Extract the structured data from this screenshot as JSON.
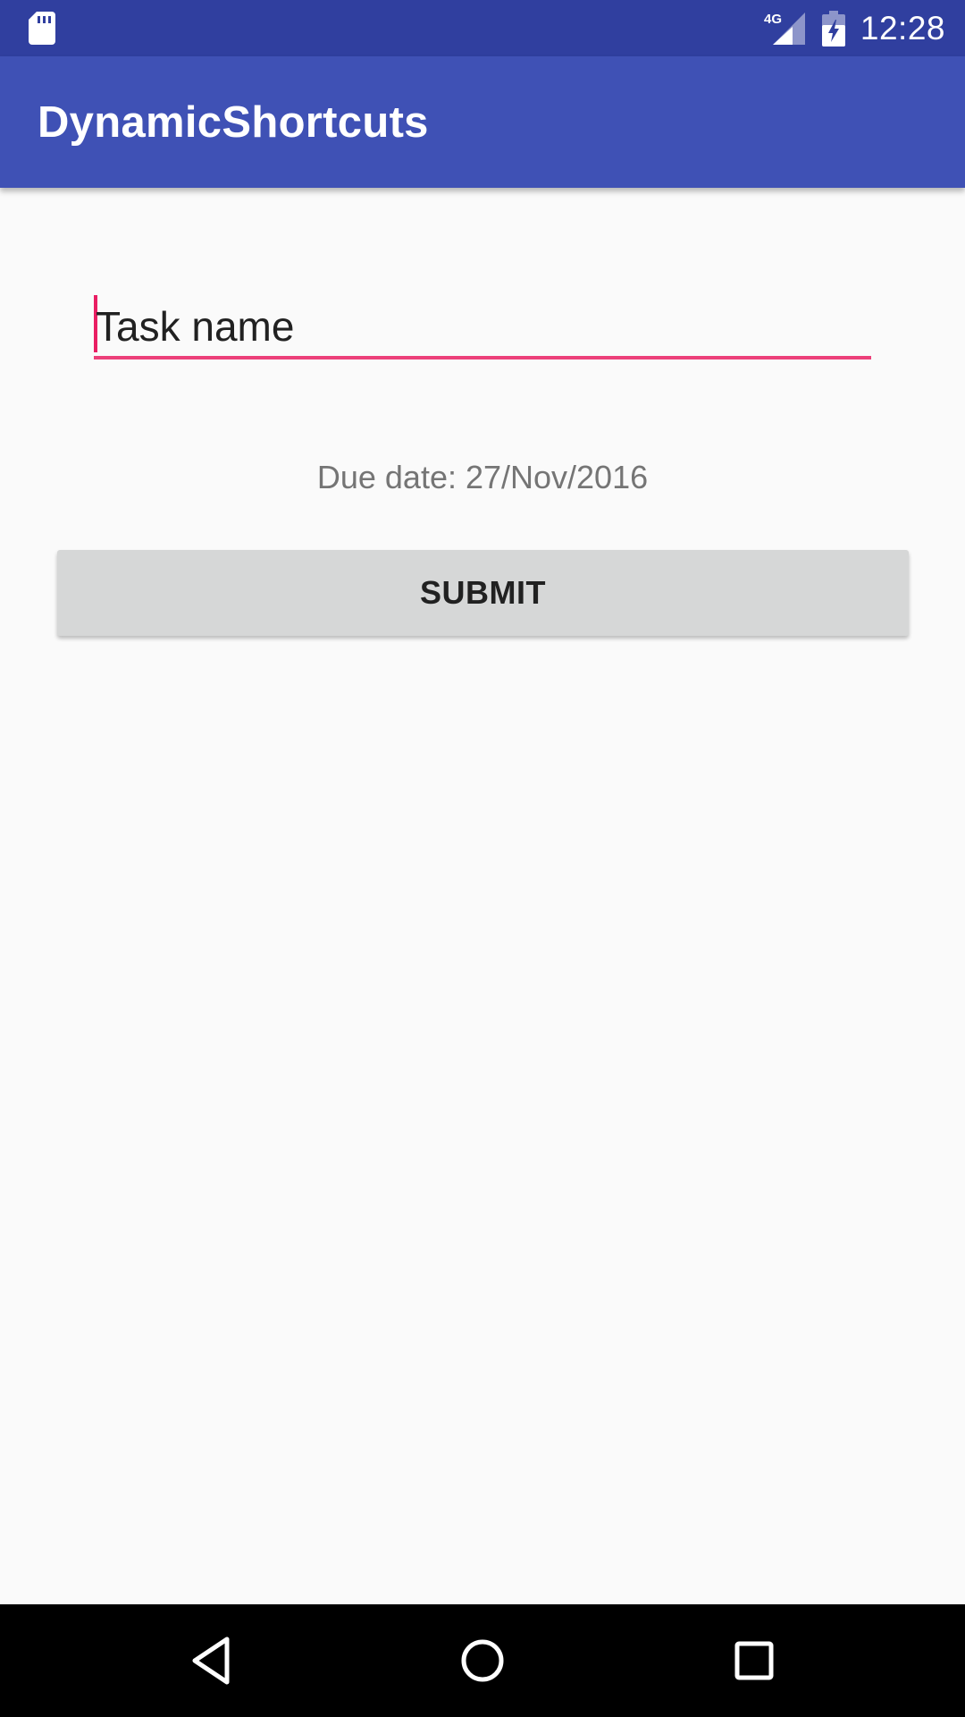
{
  "status_bar": {
    "network": "4G",
    "time": "12:28",
    "icons": [
      "sd-card-icon",
      "signal-4g-icon",
      "battery-charging-icon"
    ]
  },
  "app_bar": {
    "title": "DynamicShortcuts"
  },
  "form": {
    "task_name": {
      "value": "Task name"
    },
    "due_date_text": "Due date: 27/Nov/2016",
    "submit_label": "SUBMIT"
  },
  "nav_bar": {
    "buttons": [
      "back-icon",
      "home-icon",
      "recents-icon"
    ]
  },
  "colors": {
    "status_bar": "#303f9f",
    "app_bar": "#3f51b5",
    "accent": "#e91e63",
    "button": "#d6d7d7",
    "background": "#fafafa"
  }
}
